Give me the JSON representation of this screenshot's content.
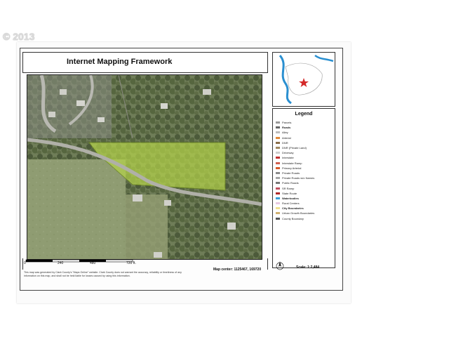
{
  "watermark": {
    "text": "© 2013"
  },
  "header": {
    "title": "Internet Mapping Framework"
  },
  "legend": {
    "title": "Legend",
    "items": [
      {
        "label": "Parcels",
        "color": "#9a9a9a",
        "head": false
      },
      {
        "label": "Roads",
        "color": "#666666",
        "head": true
      },
      {
        "label": "Alley",
        "color": "#bcbcbc",
        "head": false
      },
      {
        "label": "Arterial",
        "color": "#e08a3c",
        "head": false
      },
      {
        "label": "DNR",
        "color": "#8a6e4a",
        "head": false
      },
      {
        "label": "DNR (Private Land)",
        "color": "#a08860",
        "head": false
      },
      {
        "label": "Driveway",
        "color": "#cccccc",
        "head": false
      },
      {
        "label": "Interstate",
        "color": "#c03030",
        "head": false
      },
      {
        "label": "Interstate Ramp",
        "color": "#d06050",
        "head": false
      },
      {
        "label": "Primary Arterial",
        "color": "#d85a2a",
        "head": false
      },
      {
        "label": "Private Roads",
        "color": "#8a8a8a",
        "head": false
      },
      {
        "label": "Private Roads w/o Names",
        "color": "#a5a5a5",
        "head": false
      },
      {
        "label": "Public Roads",
        "color": "#777777",
        "head": false
      },
      {
        "label": "SR Ramp",
        "color": "#c05060",
        "head": false
      },
      {
        "label": "State Route",
        "color": "#b02a2a",
        "head": false
      },
      {
        "label": "Waterbodies",
        "color": "#3a9fd8",
        "head": true
      },
      {
        "label": "Rural Centers",
        "color": "#e7c9e0",
        "head": false
      },
      {
        "label": "City Boundaries",
        "color": "#f0e090",
        "head": true
      },
      {
        "label": "Urban Growth Boundaries",
        "color": "#d0b070",
        "head": false
      },
      {
        "label": "County Boundary",
        "color": "#555555",
        "head": false
      }
    ]
  },
  "scalebar": {
    "ticks": [
      "0",
      "240",
      "480",
      "720 ft."
    ]
  },
  "map_center": "Map center: 1125467, 169720",
  "scale": "Scale: 1:2,484",
  "disclaimer": "This map was generated by Clark County's \"Maps Online\" website. Clark County does not warrant the accuracy, reliability or timeliness of any information on this map, and shall not be held liable for losses caused by using this information."
}
